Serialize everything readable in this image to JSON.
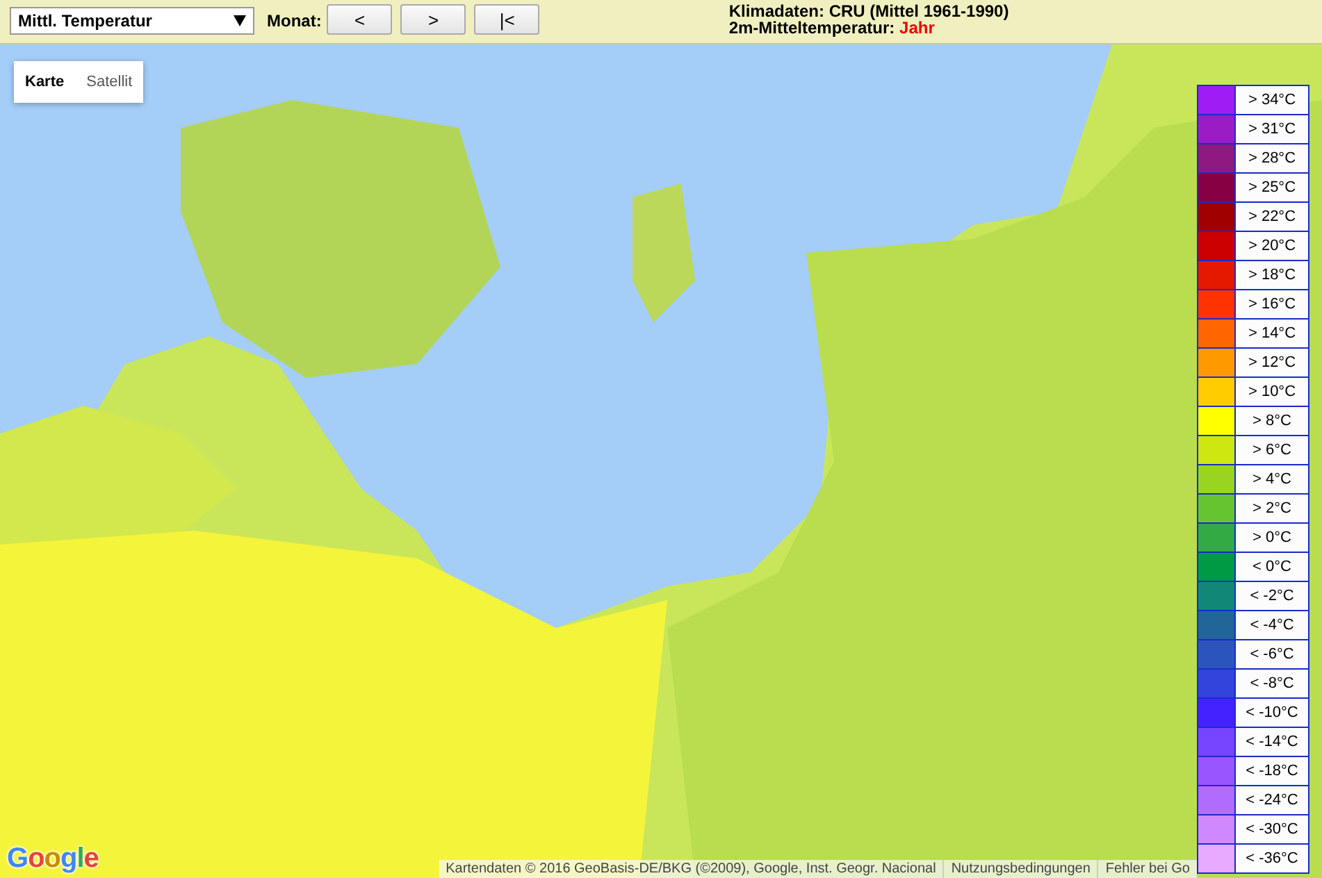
{
  "toolbar": {
    "parameter_select": {
      "value": "Mittl. Temperatur"
    },
    "month_label": "Monat:",
    "month_buttons": [
      "<",
      ">",
      "|<"
    ],
    "info": {
      "line_1": "Klimadaten: CRU (Mittel 1961-1990)",
      "line_2_label": "2m-Mitteltemperatur:",
      "line_2_value": "Jahr"
    }
  },
  "map": {
    "type_tabs": [
      {
        "label": "Karte",
        "selected": true
      },
      {
        "label": "Satellit",
        "selected": false
      }
    ],
    "logo": "Google",
    "attribution": [
      "Kartendaten © 2016 GeoBasis-DE/BKG (©2009), Google, Inst. Geogr. Nacional",
      "Nutzungsbedingungen",
      "Fehler bei Go"
    ]
  },
  "legend": [
    {
      "label": "> 34°C",
      "color": "#a01cf4"
    },
    {
      "label": "> 31°C",
      "color": "#9a1cc4"
    },
    {
      "label": "> 28°C",
      "color": "#8c1a80"
    },
    {
      "label": "> 25°C",
      "color": "#880044"
    },
    {
      "label": "> 22°C",
      "color": "#a00000"
    },
    {
      "label": "> 20°C",
      "color": "#cc0000"
    },
    {
      "label": "> 18°C",
      "color": "#e41a00"
    },
    {
      "label": "> 16°C",
      "color": "#ff3300"
    },
    {
      "label": "> 14°C",
      "color": "#ff6600"
    },
    {
      "label": "> 12°C",
      "color": "#ff9900"
    },
    {
      "label": "> 10°C",
      "color": "#ffcc00"
    },
    {
      "label": "> 8°C",
      "color": "#ffff00"
    },
    {
      "label": "> 6°C",
      "color": "#cce810"
    },
    {
      "label": "> 4°C",
      "color": "#99d420"
    },
    {
      "label": "> 2°C",
      "color": "#66c430"
    },
    {
      "label": "> 0°C",
      "color": "#33aa44"
    },
    {
      "label": "< 0°C",
      "color": "#009944"
    },
    {
      "label": "< -2°C",
      "color": "#118877"
    },
    {
      "label": "< -4°C",
      "color": "#226699"
    },
    {
      "label": "< -6°C",
      "color": "#2c55bb"
    },
    {
      "label": "< -8°C",
      "color": "#3344dd"
    },
    {
      "label": "< -10°C",
      "color": "#4422ff"
    },
    {
      "label": "< -14°C",
      "color": "#7744ff"
    },
    {
      "label": "< -18°C",
      "color": "#9955ff"
    },
    {
      "label": "< -24°C",
      "color": "#b06cff"
    },
    {
      "label": "< -30°C",
      "color": "#d088ff"
    },
    {
      "label": "< -36°C",
      "color": "#e8aaff"
    }
  ]
}
